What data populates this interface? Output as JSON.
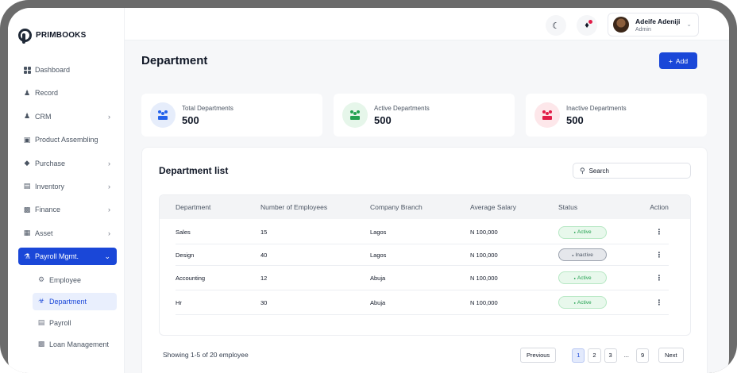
{
  "brand": {
    "name": "PRIMBOOKS"
  },
  "sidebar": {
    "items": [
      {
        "label": "Dashboard",
        "icon": "grid-icon",
        "chevron": false
      },
      {
        "label": "Record",
        "icon": "users-icon",
        "chevron": false
      },
      {
        "label": "CRM",
        "icon": "users-icon",
        "chevron": true
      },
      {
        "label": "Product Assembling",
        "icon": "box-icon",
        "chevron": false
      },
      {
        "label": "Purchase",
        "icon": "tag-icon",
        "chevron": true
      },
      {
        "label": "Inventory",
        "icon": "archive-icon",
        "chevron": true
      },
      {
        "label": "Finance",
        "icon": "money-icon",
        "chevron": true
      },
      {
        "label": "Asset",
        "icon": "briefcase-icon",
        "chevron": true
      },
      {
        "label": "Payroll Mgmt.",
        "icon": "payroll-icon",
        "chevron": true,
        "active": true
      }
    ],
    "sub_items": [
      {
        "label": "Employee",
        "icon": "employee-icon"
      },
      {
        "label": "Department",
        "icon": "department-icon",
        "active": true
      },
      {
        "label": "Payroll",
        "icon": "payroll-doc-icon"
      },
      {
        "label": "Loan Management",
        "icon": "loan-icon"
      }
    ]
  },
  "topbar": {
    "user_name": "Adeife Adeniji",
    "user_role": "Admin"
  },
  "page": {
    "title": "Department",
    "add_label": "Add"
  },
  "stats": [
    {
      "label": "Total Departments",
      "value": "500",
      "color": "#2563eb",
      "bg": "#e6edfb"
    },
    {
      "label": "Active Departments",
      "value": "500",
      "color": "#22a150",
      "bg": "#e6f6ea"
    },
    {
      "label": "Inactive Departments",
      "value": "500",
      "color": "#e11d48",
      "bg": "#fde7ea"
    }
  ],
  "list": {
    "title": "Department list",
    "search_placeholder": "Search",
    "columns": [
      "Department",
      "Number of Employees",
      "Company Branch",
      "Average Salary",
      "Status",
      "Action"
    ],
    "rows": [
      {
        "department": "Sales",
        "employees": "15",
        "branch": "Lagos",
        "salary": "N 100,000",
        "status": "Active",
        "status_type": "active"
      },
      {
        "department": "Design",
        "employees": "40",
        "branch": "Lagos",
        "salary": "N 100,000",
        "status": "Inactive",
        "status_type": "inactive"
      },
      {
        "department": "Accounting",
        "employees": "12",
        "branch": "Abuja",
        "salary": "N 100,000",
        "status": "Active",
        "status_type": "active"
      },
      {
        "department": "Hr",
        "employees": "30",
        "branch": "Abuja",
        "salary": "N 100,000",
        "status": "Active",
        "status_type": "active"
      }
    ],
    "action_glyph": "⋮",
    "status_dot": "●"
  },
  "pagination": {
    "showing": "Showing 1-5 of 20 employee",
    "previous": "Previous",
    "pages": [
      "1",
      "2",
      "3"
    ],
    "ellipsis": "...",
    "last": "9",
    "next": "Next",
    "current": "1"
  }
}
